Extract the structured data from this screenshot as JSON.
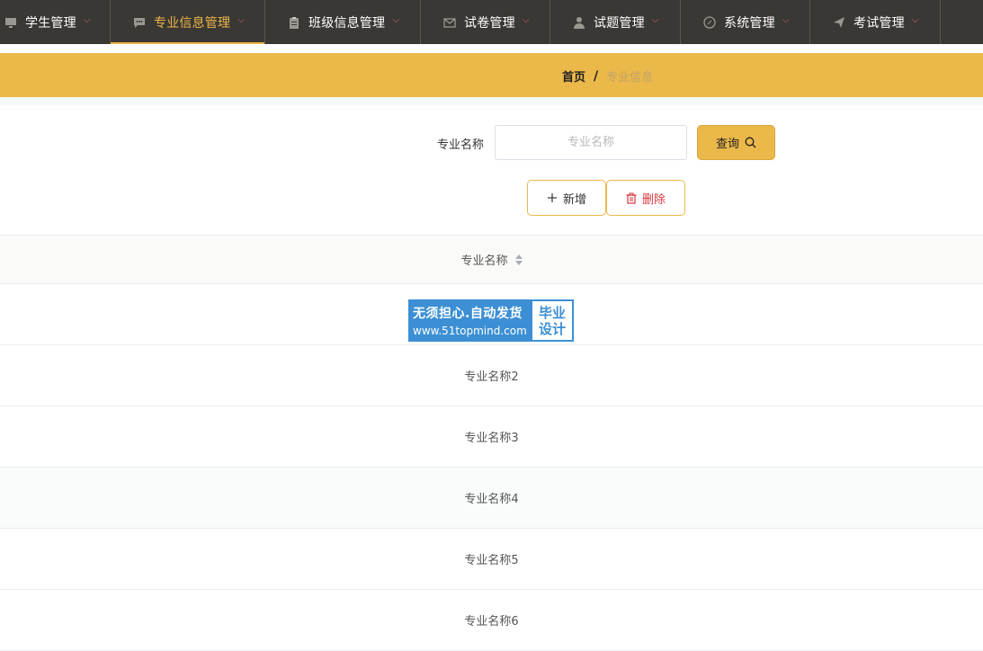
{
  "nav": {
    "items": [
      {
        "label": "学生管理",
        "icon": "monitor-icon"
      },
      {
        "label": "专业信息管理",
        "icon": "chat-icon",
        "active": true
      },
      {
        "label": "班级信息管理",
        "icon": "clipboard-icon"
      },
      {
        "label": "试卷管理",
        "icon": "mail-icon"
      },
      {
        "label": "试题管理",
        "icon": "user-icon"
      },
      {
        "label": "系统管理",
        "icon": "compass-icon"
      },
      {
        "label": "考试管理",
        "icon": "send-icon"
      }
    ],
    "accent_color": "#ebb54a",
    "background_color": "#3a3834"
  },
  "breadcrumb": {
    "home": "首页",
    "separator": "/",
    "current": "专业信息"
  },
  "search": {
    "label": "专业名称",
    "placeholder": "专业名称",
    "value": "",
    "button_label": "查询"
  },
  "actions": {
    "add_label": "新增",
    "delete_label": "删除"
  },
  "table": {
    "columns": [
      "专业名称"
    ],
    "rows": [
      {
        "name": ""
      },
      {
        "name": "专业名称2"
      },
      {
        "name": "专业名称3"
      },
      {
        "name": "专业名称4"
      },
      {
        "name": "专业名称5"
      },
      {
        "name": "专业名称6"
      }
    ]
  },
  "watermark": {
    "line1": "无须担心.自动发货",
    "line2": "www.51topmind.com",
    "right_line1": "毕业",
    "right_line2": "设计"
  },
  "colors": {
    "brand_yellow": "#ebb84a",
    "delete_red": "#d9363e",
    "watermark_blue": "#3c8fd4"
  }
}
